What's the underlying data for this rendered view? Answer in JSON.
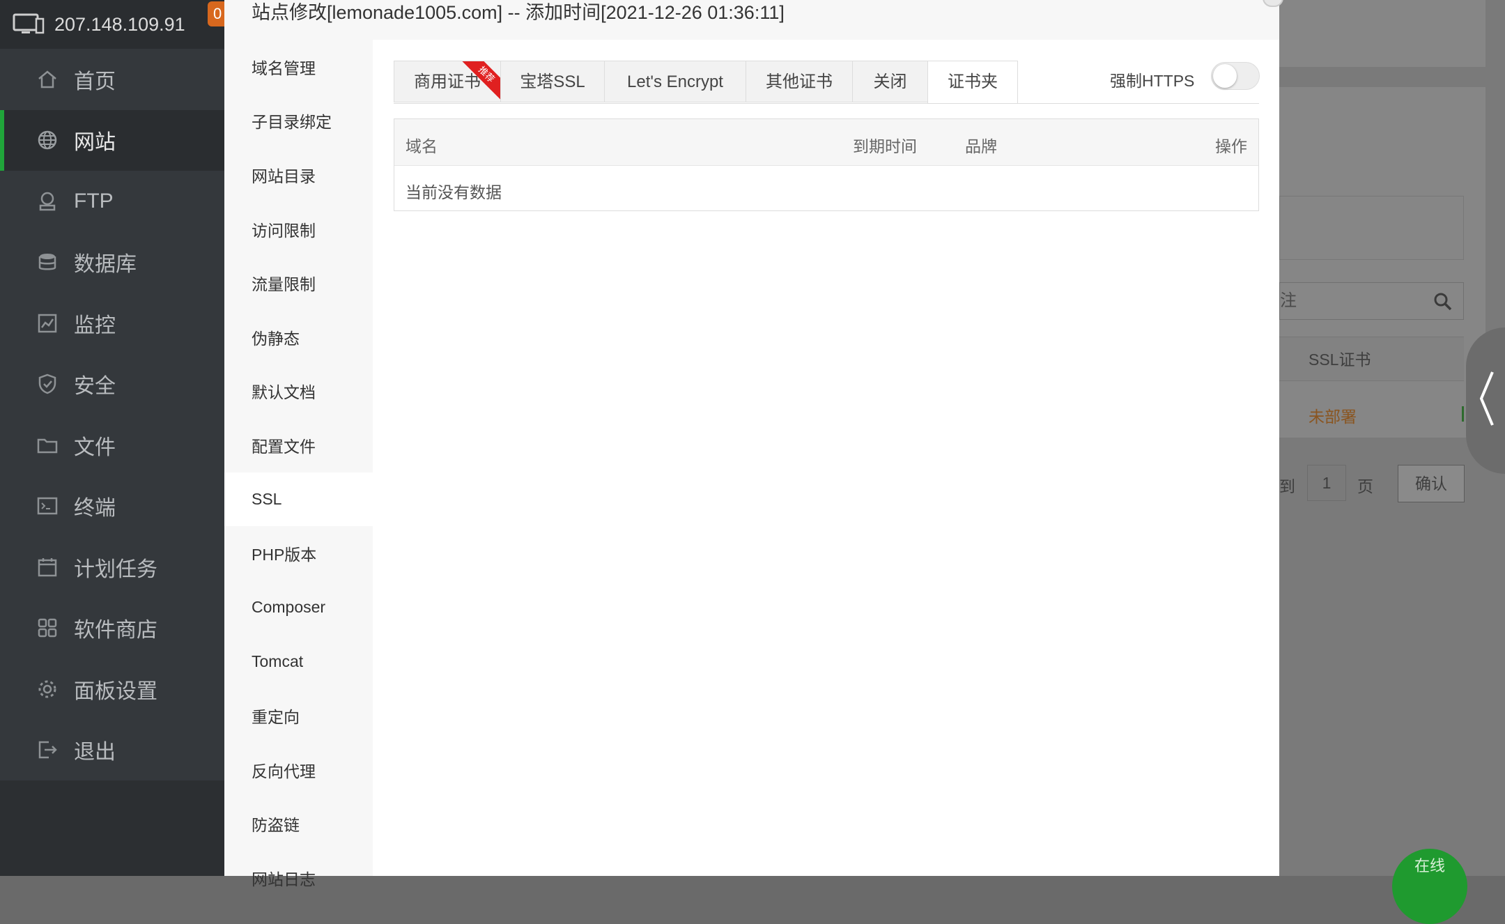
{
  "server": {
    "ip": "207.148.109.91",
    "badge": "0"
  },
  "sidebar": {
    "items": [
      {
        "label": "首页",
        "icon": "home-icon"
      },
      {
        "label": "网站",
        "icon": "globe-icon",
        "active": true
      },
      {
        "label": "FTP",
        "icon": "ftp-icon"
      },
      {
        "label": "数据库",
        "icon": "database-icon"
      },
      {
        "label": "监控",
        "icon": "monitor-chart-icon"
      },
      {
        "label": "安全",
        "icon": "shield-icon"
      },
      {
        "label": "文件",
        "icon": "folder-icon"
      },
      {
        "label": "终端",
        "icon": "terminal-icon"
      },
      {
        "label": "计划任务",
        "icon": "calendar-icon"
      },
      {
        "label": "软件商店",
        "icon": "grid-icon"
      },
      {
        "label": "面板设置",
        "icon": "gear-icon"
      },
      {
        "label": "退出",
        "icon": "logout-icon"
      }
    ]
  },
  "modal": {
    "title": "站点修改[lemonade1005.com] -- 添加时间[2021-12-26 01:36:11]",
    "menu": [
      "域名管理",
      "子目录绑定",
      "网站目录",
      "访问限制",
      "流量限制",
      "伪静态",
      "默认文档",
      "配置文件",
      "SSL",
      "PHP版本",
      "Composer",
      "Tomcat",
      "重定向",
      "反向代理",
      "防盗链",
      "网站日志"
    ],
    "active_menu": "SSL",
    "tabs": [
      {
        "label": "商用证书",
        "ribbon": "推荐"
      },
      {
        "label": "宝塔SSL"
      },
      {
        "label": "Let's Encrypt"
      },
      {
        "label": "其他证书"
      },
      {
        "label": "关闭"
      },
      {
        "label": "证书夹",
        "active": true
      }
    ],
    "force_https": {
      "label": "强制HTTPS",
      "enabled": false
    },
    "table": {
      "columns": [
        "域名",
        "到期时间",
        "品牌",
        "操作"
      ],
      "empty_text": "当前没有数据"
    }
  },
  "background_page": {
    "search_placeholder_fragment": "注",
    "ssl_header": "SSL证书",
    "ssl_status": "未部署",
    "pager": {
      "goto_prefix": "到",
      "page_value": "1",
      "page_suffix": "页",
      "confirm": "确认"
    },
    "online_button": "在线"
  },
  "colors": {
    "accent_green": "#20a53a",
    "ribbon_red": "#e02020",
    "warning_orange": "#d8681e"
  }
}
